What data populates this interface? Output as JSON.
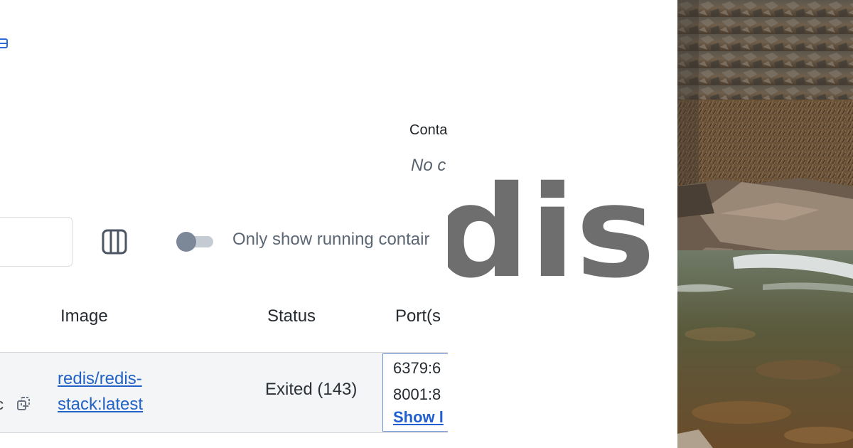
{
  "containers_summary": {
    "label": "Conta",
    "value": "No c"
  },
  "toolbar": {
    "search_placeholder": "",
    "running_toggle_label": "Only show running contair"
  },
  "table": {
    "columns": [
      "Image",
      "Status",
      "Port(s"
    ],
    "rows": [
      {
        "id_fragment": "c",
        "image": [
          "redis/redis-",
          "stack:latest"
        ],
        "status": "Exited (143)",
        "ports": [
          "6379:6",
          "8001:8"
        ],
        "ports_link": "Show l"
      }
    ]
  },
  "wordmark": {
    "text": "dis",
    "color": "#6e6e6e"
  },
  "colors": {
    "link": "#2262c6",
    "muted_text": "#5c6775",
    "row_background": "#f4f5f7"
  },
  "icons": [
    "container-icon",
    "columns-icon",
    "copy-icon"
  ]
}
